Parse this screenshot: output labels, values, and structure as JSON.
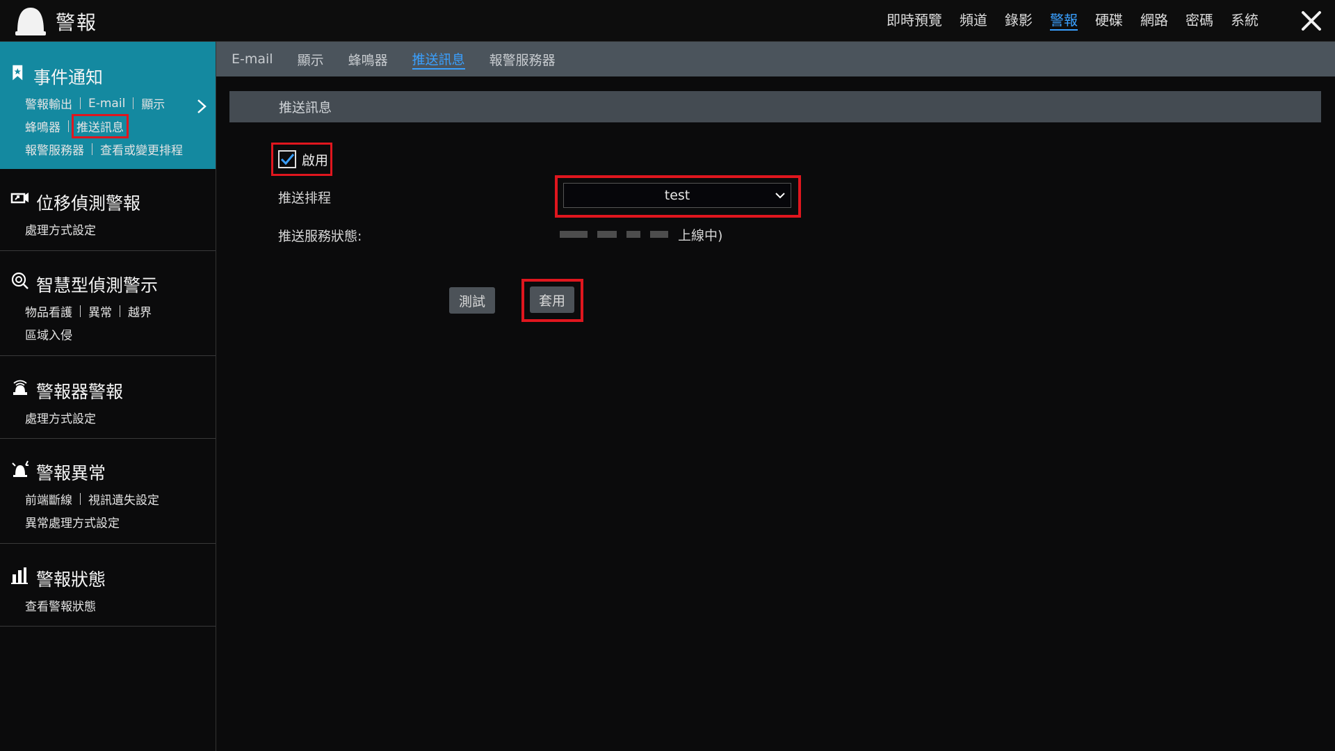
{
  "app": {
    "title": "警報"
  },
  "topnav": {
    "items": [
      {
        "label": "即時預覽"
      },
      {
        "label": "頻道"
      },
      {
        "label": "錄影"
      },
      {
        "label": "警報",
        "active": true
      },
      {
        "label": "硬碟"
      },
      {
        "label": "網路"
      },
      {
        "label": "密碼"
      },
      {
        "label": "系統"
      }
    ],
    "active_color": "#3aa0ff"
  },
  "sidebar": {
    "sections": [
      {
        "title": "事件通知",
        "icon": "bookmark-star-icon",
        "active": true,
        "rows": [
          [
            "警報輸出",
            "E-mail",
            "顯示"
          ],
          [
            "蜂鳴器",
            "推送訊息"
          ],
          [
            "報警服務器",
            "查看或變更排程"
          ]
        ]
      },
      {
        "title": "位移偵測警報",
        "icon": "motion-detect-icon",
        "rows": [
          [
            "處理方式設定"
          ]
        ]
      },
      {
        "title": "智慧型偵測警示",
        "icon": "smart-detect-icon",
        "rows": [
          [
            "物品看護",
            "異常",
            "越界"
          ],
          [
            "區域入侵"
          ]
        ]
      },
      {
        "title": "警報器警報",
        "icon": "siren-icon",
        "rows": [
          [
            "處理方式設定"
          ]
        ]
      },
      {
        "title": "警報異常",
        "icon": "alarm-exception-icon",
        "rows": [
          [
            "前端斷線",
            "視訊遺失設定"
          ],
          [
            "異常處理方式設定"
          ]
        ]
      },
      {
        "title": "警報狀態",
        "icon": "bar-chart-icon",
        "rows": [
          [
            "查看警報狀態"
          ]
        ]
      }
    ],
    "active_color": "#1489a0"
  },
  "subtabs": {
    "items": [
      {
        "label": "E-mail"
      },
      {
        "label": "顯示"
      },
      {
        "label": "蜂鳴器"
      },
      {
        "label": "推送訊息",
        "active": true
      },
      {
        "label": "報警服務器"
      }
    ]
  },
  "panel": {
    "header": "推送訊息",
    "enable_label": "啟用",
    "enable_checked": true,
    "schedule_label": "推送排程",
    "schedule_value": "test",
    "status_label": "推送服務狀態:",
    "status_value": "上線中)",
    "test_button": "測試",
    "apply_button": "套用"
  },
  "colors": {
    "highlight": "#e0161e"
  }
}
